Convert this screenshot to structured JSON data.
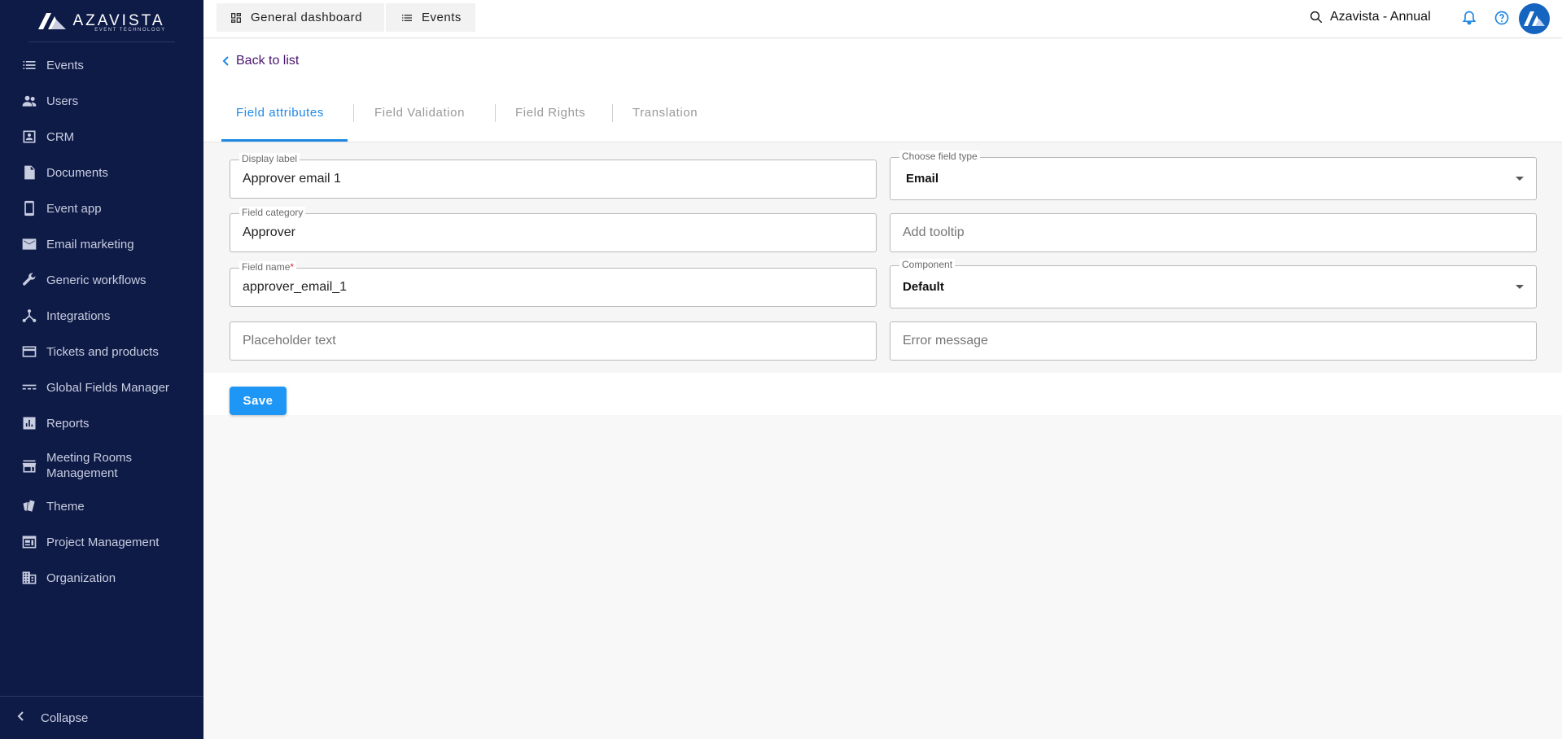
{
  "brand": {
    "name": "AZAVISTA",
    "tagline": "EVENT TECHNOLOGY"
  },
  "sidebar": {
    "items": [
      {
        "label": "Events",
        "icon": "list-icon"
      },
      {
        "label": "Users",
        "icon": "users-icon"
      },
      {
        "label": "CRM",
        "icon": "contact-card-icon"
      },
      {
        "label": "Documents",
        "icon": "document-icon"
      },
      {
        "label": "Event app",
        "icon": "phone-icon"
      },
      {
        "label": "Email marketing",
        "icon": "mail-icon"
      },
      {
        "label": "Generic workflows",
        "icon": "wrench-icon"
      },
      {
        "label": "Integrations",
        "icon": "network-icon"
      },
      {
        "label": "Tickets and products",
        "icon": "card-icon"
      },
      {
        "label": "Global Fields Manager",
        "icon": "fields-icon"
      },
      {
        "label": "Reports",
        "icon": "chart-icon"
      },
      {
        "label": "Meeting Rooms",
        "label2": "Management",
        "icon": "store-icon"
      },
      {
        "label": "Theme",
        "icon": "palette-icon"
      },
      {
        "label": "Project Management",
        "icon": "dashboard-window-icon"
      },
      {
        "label": "Organization",
        "icon": "building-icon"
      }
    ],
    "collapse_label": "Collapse"
  },
  "topbar": {
    "tabs": [
      {
        "label": "General dashboard",
        "icon": "grid-icon"
      },
      {
        "label": "Events",
        "icon": "list-icon"
      }
    ],
    "search_text": "Azavista - Annual"
  },
  "page": {
    "back_label": "Back to list",
    "tabs": [
      {
        "label": "Field attributes",
        "active": true
      },
      {
        "label": "Field Validation",
        "active": false
      },
      {
        "label": "Field Rights",
        "active": false
      },
      {
        "label": "Translation",
        "active": false
      }
    ]
  },
  "form": {
    "display_label": {
      "label": "Display label",
      "value": "Approver email 1"
    },
    "field_type": {
      "label": "Choose field type",
      "value": "Email"
    },
    "field_category": {
      "label": "Field category",
      "value": "Approver"
    },
    "tooltip": {
      "placeholder": "Add tooltip"
    },
    "field_name": {
      "label": "Field name",
      "required_mark": "*",
      "value": "approver_email_1"
    },
    "component": {
      "label": "Component",
      "value": "Default"
    },
    "placeholder_text": {
      "placeholder": "Placeholder text"
    },
    "error_message": {
      "placeholder": "Error message"
    },
    "save_label": "Save"
  },
  "colors": {
    "sidebar_bg": "#0f1b47",
    "accent": "#1e88e5",
    "save_button": "#1e96f5"
  }
}
